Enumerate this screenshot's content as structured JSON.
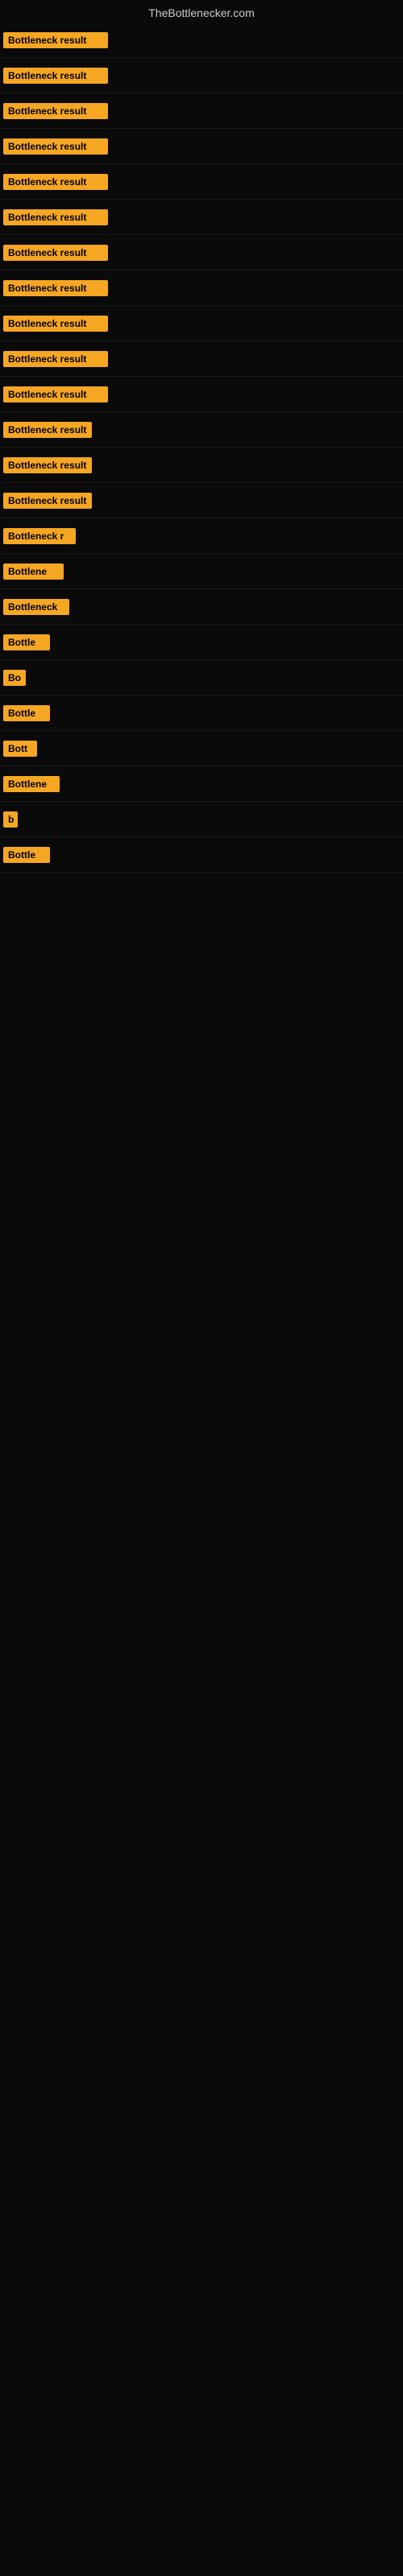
{
  "site": {
    "title": "TheBottlenecker.com"
  },
  "rows": [
    {
      "id": 1,
      "label": "Bottleneck result",
      "width": 130
    },
    {
      "id": 2,
      "label": "Bottleneck result",
      "width": 130
    },
    {
      "id": 3,
      "label": "Bottleneck result",
      "width": 130
    },
    {
      "id": 4,
      "label": "Bottleneck result",
      "width": 130
    },
    {
      "id": 5,
      "label": "Bottleneck result",
      "width": 130
    },
    {
      "id": 6,
      "label": "Bottleneck result",
      "width": 130
    },
    {
      "id": 7,
      "label": "Bottleneck result",
      "width": 130
    },
    {
      "id": 8,
      "label": "Bottleneck result",
      "width": 130
    },
    {
      "id": 9,
      "label": "Bottleneck result",
      "width": 130
    },
    {
      "id": 10,
      "label": "Bottleneck result",
      "width": 130
    },
    {
      "id": 11,
      "label": "Bottleneck result",
      "width": 130
    },
    {
      "id": 12,
      "label": "Bottleneck result",
      "width": 110
    },
    {
      "id": 13,
      "label": "Bottleneck result",
      "width": 110
    },
    {
      "id": 14,
      "label": "Bottleneck result",
      "width": 110
    },
    {
      "id": 15,
      "label": "Bottleneck r",
      "width": 90
    },
    {
      "id": 16,
      "label": "Bottlene",
      "width": 75
    },
    {
      "id": 17,
      "label": "Bottleneck",
      "width": 82
    },
    {
      "id": 18,
      "label": "Bottle",
      "width": 58
    },
    {
      "id": 19,
      "label": "Bo",
      "width": 28
    },
    {
      "id": 20,
      "label": "Bottle",
      "width": 58
    },
    {
      "id": 21,
      "label": "Bott",
      "width": 42
    },
    {
      "id": 22,
      "label": "Bottlene",
      "width": 70
    },
    {
      "id": 23,
      "label": "b",
      "width": 18
    },
    {
      "id": 24,
      "label": "Bottle",
      "width": 58
    }
  ],
  "colors": {
    "badge_bg": "#f5a623",
    "badge_text": "#000000",
    "site_title": "#cccccc",
    "background": "#0a0a0a"
  }
}
